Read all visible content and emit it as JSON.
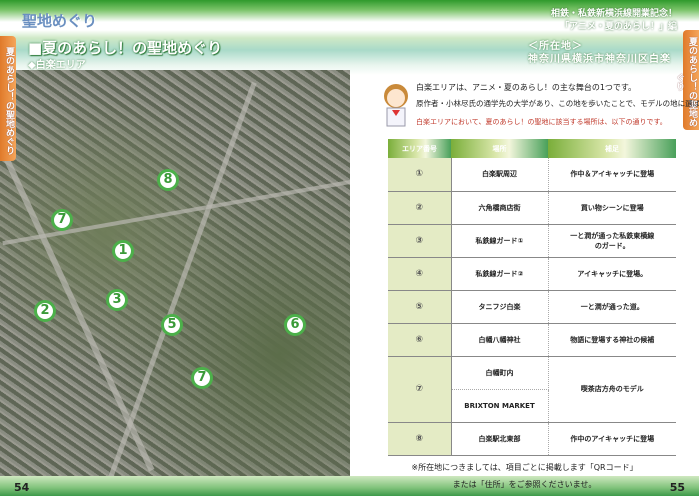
{
  "left": {
    "logo": "聖地めぐり",
    "title": "■夏のあらし！の聖地めぐり",
    "subtitle": "◆白楽エリア",
    "side_tab": "夏のあらし！の聖地めぐり",
    "page_number": "54",
    "map_pins": [
      "8",
      "7",
      "1",
      "3",
      "2",
      "5",
      "6",
      "7"
    ]
  },
  "right": {
    "series_line1": "相鉄・私鉄新横浜線開業記念！",
    "series_line2": "「アニメ・夏のあらし！」編",
    "location_label": "＜所在地＞",
    "location": "神奈川県横浜市神奈川区白楽",
    "intro1": "白楽エリアは、アニメ・夏のあらし！の主な舞台の1つです。",
    "intro2": "原作者・小林尽氏の通学先の大学があり、この地を歩いたことで、モデルの地に選ばれました。",
    "intro3": "白楽エリアにおいて、夏のあらし！の聖地に該当する場所は、以下の通りです。",
    "side_tab": "夏のあらし！の聖地めぐり",
    "page_number": "55",
    "table": {
      "headers": [
        "エリア番号",
        "場所",
        "補足"
      ],
      "rows": [
        {
          "num": "①",
          "place": "白楽駅周辺",
          "note": "作中＆アイキャッチに登場"
        },
        {
          "num": "②",
          "place": "六角橋商店街",
          "note": "買い物シーンに登場"
        },
        {
          "num": "③",
          "place": "私鉄線ガード①",
          "note": "一と潤が通った私鉄東横線のガード。"
        },
        {
          "num": "④",
          "place": "私鉄線ガード②",
          "note": "アイキャッチに登場。"
        },
        {
          "num": "⑤",
          "place": "タニフジ白楽",
          "note": "一と潤が通った道。"
        },
        {
          "num": "⑥",
          "place": "白幡八幡神社",
          "note": "物語に登場する神社の候補"
        },
        {
          "num": "⑦",
          "place": "白幡町内",
          "place2": "BRIXTON MARKET",
          "note": "喫茶店方舟のモデル"
        },
        {
          "num": "⑧",
          "place": "白楽駅北東部",
          "note": "作中のアイキャッチに登場"
        }
      ]
    },
    "footnote1": "※所在地につきましては、項目ごとに掲載します「QRコード」",
    "footnote2": "または「住所」をご参照くださいませ。"
  },
  "colors": {
    "green": "#4cb04a",
    "orange": "#e07a2a"
  }
}
